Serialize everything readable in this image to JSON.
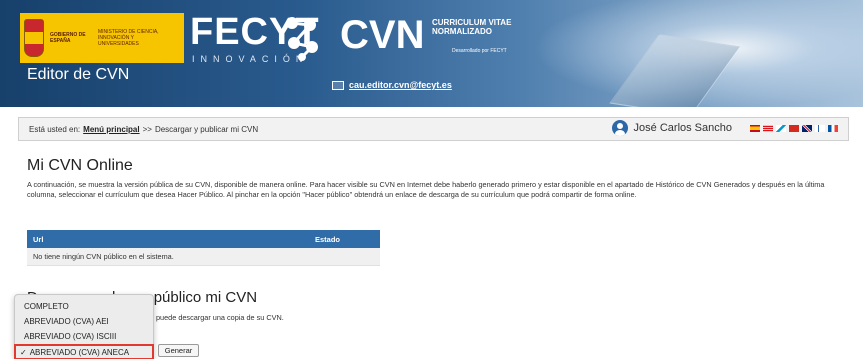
{
  "header": {
    "gov_text": "GOBIERNO DE ESPAÑA",
    "ministry_text": "MINISTERIO DE CIENCIA, INNOVACIÓN Y UNIVERSIDADES",
    "fecyt": "FECYT",
    "innovacion": "INNOVACIÓN",
    "cvn": "CVN",
    "cvn_sub": "CURRICULUM VITAE NORMALIZADO",
    "cvn_dev": "Desarrollado por FECYT",
    "editor_title": "Editor de CVN",
    "email": "cau.editor.cvn@fecyt.es",
    "colors": {
      "banner": "#2a5b8e",
      "logo_bg": "#f7c500"
    }
  },
  "breadcrumb": {
    "prefix": "Está usted en:",
    "menu_link": "Menú principal",
    "separator": ">>",
    "current": "Descargar y publicar mi CVN"
  },
  "user": {
    "name": "José Carlos Sancho",
    "icon": "user-avatar-icon"
  },
  "main": {
    "title": "Mi CVN Online",
    "description": "A continuación, se muestra la versión pública de su CVN, disponible de manera online. Para hacer visible su CVN en Internet debe haberlo generado primero y estar disponible en el apartado de Histórico de CVN Generados y después en la última columna, seleccionar el currículum que desea Hacer Público. Al pinchar en la opción \"Hacer público\" obtendrá un enlace de descarga de su currículum que podrá compartir de forma online.",
    "table": {
      "headers": [
        "Url",
        "Estado"
      ],
      "empty_message": "No tiene ningún CVN público en el sistema.",
      "header_color": "#2f6ca8"
    },
    "section_title": "Descargar y hacer público mi CVN",
    "section_sub": "puede descargar una copia de su CVN.",
    "dropdown": {
      "options": [
        "COMPLETO",
        "ABREVIADO (CVA) AEI",
        "ABREVIADO (CVA) ISCIII",
        "ABREVIADO (CVA) ANECA"
      ],
      "selected": "ABREVIADO (CVA) ANECA",
      "highlight_color": "#e03a2f"
    },
    "generate_button": "Generar"
  }
}
